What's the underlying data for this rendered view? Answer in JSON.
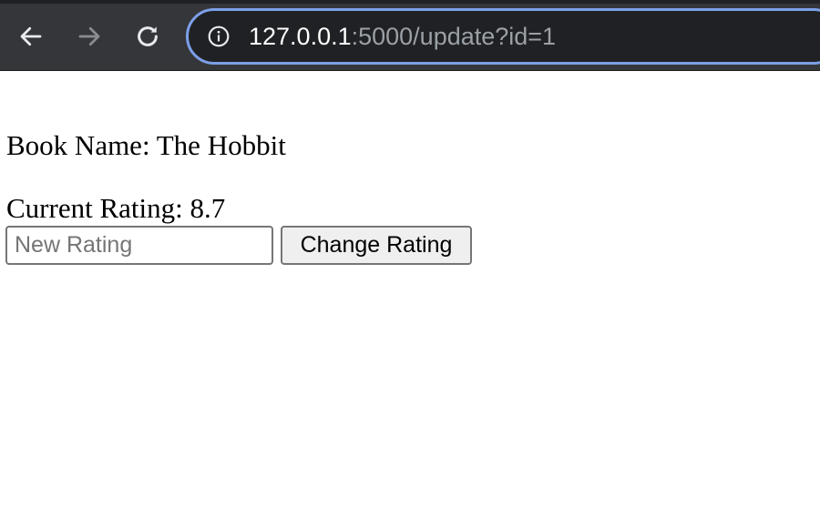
{
  "browser": {
    "url_host": "127.0.0.1",
    "url_rest": ":5000/update?id=1",
    "icons": {
      "back": "arrow-left-icon",
      "forward": "arrow-right-icon",
      "reload": "reload-icon",
      "site_info": "info-icon"
    },
    "colors": {
      "toolbar": "#35363a",
      "omnibox": "#202124",
      "focus_ring": "#7ca0e8"
    }
  },
  "page": {
    "book_label": "Book Name: The Hobbit",
    "rating_label": "Current Rating: 8.7",
    "new_rating": {
      "value": "",
      "placeholder": "New Rating"
    },
    "submit_label": "Change Rating"
  }
}
